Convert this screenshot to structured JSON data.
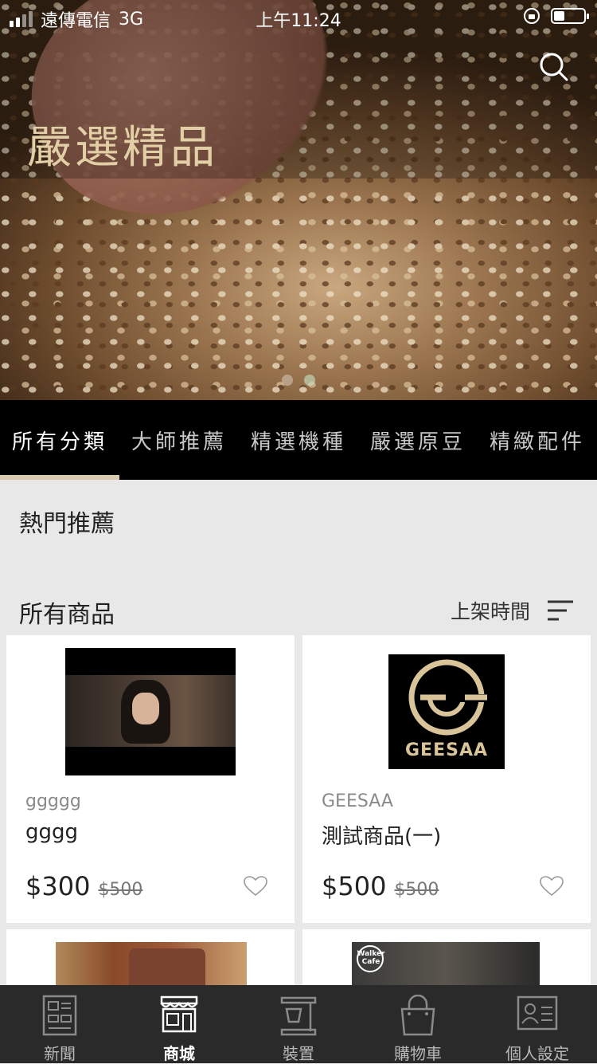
{
  "status": {
    "carrier": "遠傳電信",
    "network": "3G",
    "time": "上午11:24",
    "battery_level": 0.35
  },
  "hero": {
    "title": "嚴選精品"
  },
  "tabs": [
    {
      "label": "所有分類"
    },
    {
      "label": "大師推薦"
    },
    {
      "label": "精選機種"
    },
    {
      "label": "嚴選原豆"
    },
    {
      "label": "精緻配件"
    }
  ],
  "sections": {
    "hot": "熱門推薦",
    "all": "所有商品",
    "sort": "上架時間"
  },
  "products": [
    {
      "brand": "ggggg",
      "name": "gggg",
      "price": "$300",
      "old_price": "$500"
    },
    {
      "brand": "GEESAA",
      "name": "測試商品(一)",
      "price": "$500",
      "old_price": "$500",
      "logo_text": "GEESAA"
    },
    {
      "brand": "",
      "name": "",
      "price": "",
      "old_price": ""
    },
    {
      "brand": "",
      "name": "",
      "price": "",
      "old_price": "",
      "logo_text": "Walker Cafe"
    }
  ],
  "nav": [
    {
      "label": "新聞",
      "icon": "news-icon"
    },
    {
      "label": "商城",
      "icon": "store-icon"
    },
    {
      "label": "裝置",
      "icon": "device-icon"
    },
    {
      "label": "購物車",
      "icon": "cart-icon"
    },
    {
      "label": "個人設定",
      "icon": "profile-icon"
    }
  ],
  "colors": {
    "accent": "#d8cbb0",
    "hero_title": "#e3cfa6",
    "tabbar": "#000000",
    "navbar": "#2a2a2a"
  }
}
